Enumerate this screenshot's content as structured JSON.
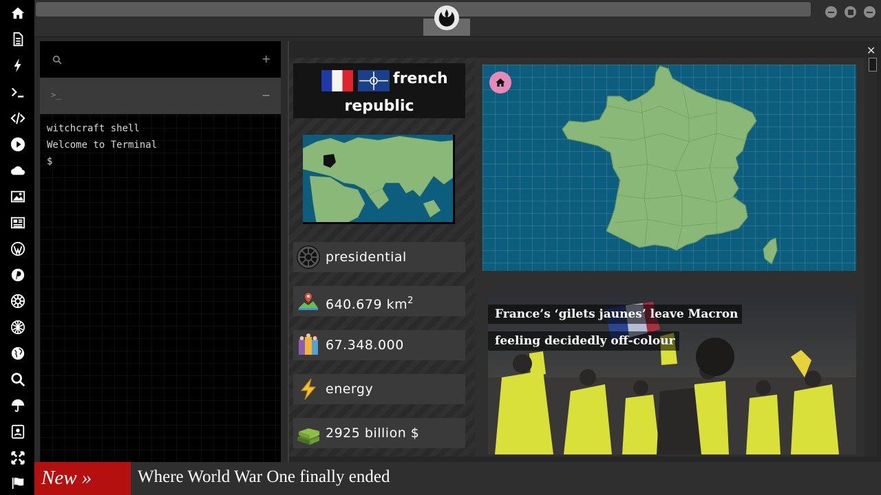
{
  "window": {
    "top_search_placeholder": "",
    "logo_icon": "rebel-alliance-icon",
    "controls": [
      "minimize-icon",
      "maximize-icon",
      "close-icon"
    ]
  },
  "sidebar": {
    "items": [
      {
        "icon": "home-icon"
      },
      {
        "icon": "document-icon"
      },
      {
        "icon": "lightning-icon"
      },
      {
        "icon": "terminal-icon"
      },
      {
        "icon": "code-icon"
      },
      {
        "icon": "play-icon"
      },
      {
        "icon": "cloud-icon"
      },
      {
        "icon": "image-icon"
      },
      {
        "icon": "newspaper-icon"
      },
      {
        "icon": "wordpress-icon"
      },
      {
        "icon": "pinterest-icon"
      },
      {
        "icon": "galactic-empire-icon"
      },
      {
        "icon": "jedi-order-icon"
      },
      {
        "icon": "globe-icon"
      },
      {
        "icon": "search-icon"
      },
      {
        "icon": "umbrella-icon"
      },
      {
        "icon": "contact-icon"
      },
      {
        "icon": "expand-icon"
      },
      {
        "icon": "flag-icon"
      }
    ]
  },
  "terminal": {
    "search_plus": "+",
    "tab_prompt": ">_",
    "tab_minus": "−",
    "lines": [
      "witchcraft shell",
      "Welcome to Terminal",
      "$"
    ]
  },
  "country": {
    "name_line1": "french",
    "name_line2": "republic",
    "flags": [
      "france-flag",
      "nato-flag"
    ],
    "government": "presidential",
    "area_value": "640.679 km",
    "area_exp": "2",
    "population": "67.348.000",
    "economy_sector": "energy",
    "gdp": "2925 billion $"
  },
  "colors": {
    "map_sea": "#0c5d7e",
    "map_land": "#8ab878",
    "ticker_accent": "#b51010",
    "home_button": "#e58ab8"
  },
  "news": {
    "headline": "France’s ‘gilets jaunes’ leave Macron feeling decidedly off-colour"
  },
  "ticker": {
    "label": "New »",
    "text": "Where World War One finally ended"
  }
}
